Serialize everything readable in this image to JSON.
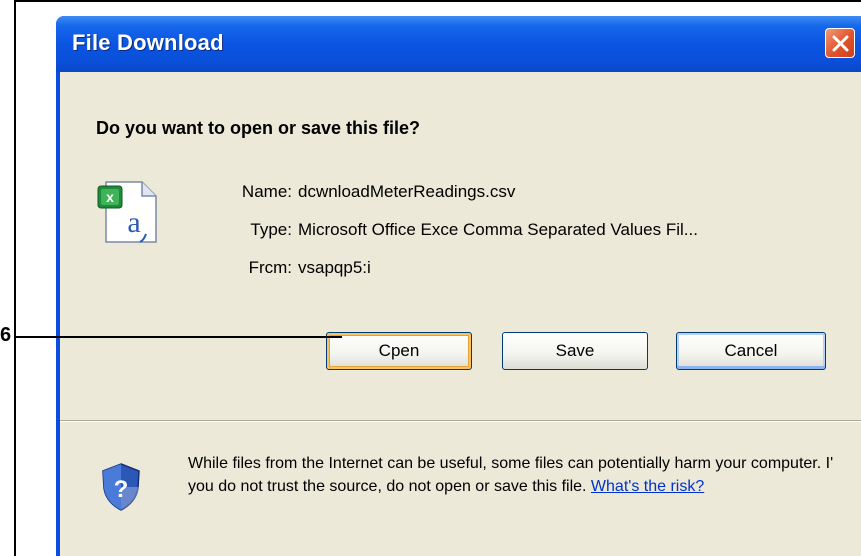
{
  "dialog": {
    "title": "File Download",
    "question": "Do you want to open or save this file?",
    "fields": [
      {
        "label": "Name:",
        "value": "dcwnloadMeterReadings.csv"
      },
      {
        "label": "Type:",
        "value": "Microsoft Office Exce Comma Separated Values Fil..."
      },
      {
        "label": "Frcm:",
        "value": "vsapqp5:i"
      }
    ],
    "buttons": {
      "open": "Cpen",
      "save": "Save",
      "cancel": "Cancel"
    },
    "warning": {
      "text": "While files from the Internet can be useful, some files can potentially harm your computer. I' you do not trust the source, do not open or save this file.",
      "link": "What's the risk?"
    },
    "icons": {
      "file": "excel-csv-file-icon",
      "shield": "security-shield-icon",
      "close": "close-icon"
    }
  },
  "callout": {
    "number": "6"
  },
  "colors": {
    "titlebar": "#0b55e3",
    "body": "#ece9d8",
    "close": "#e0542c",
    "link": "#0033cc"
  }
}
